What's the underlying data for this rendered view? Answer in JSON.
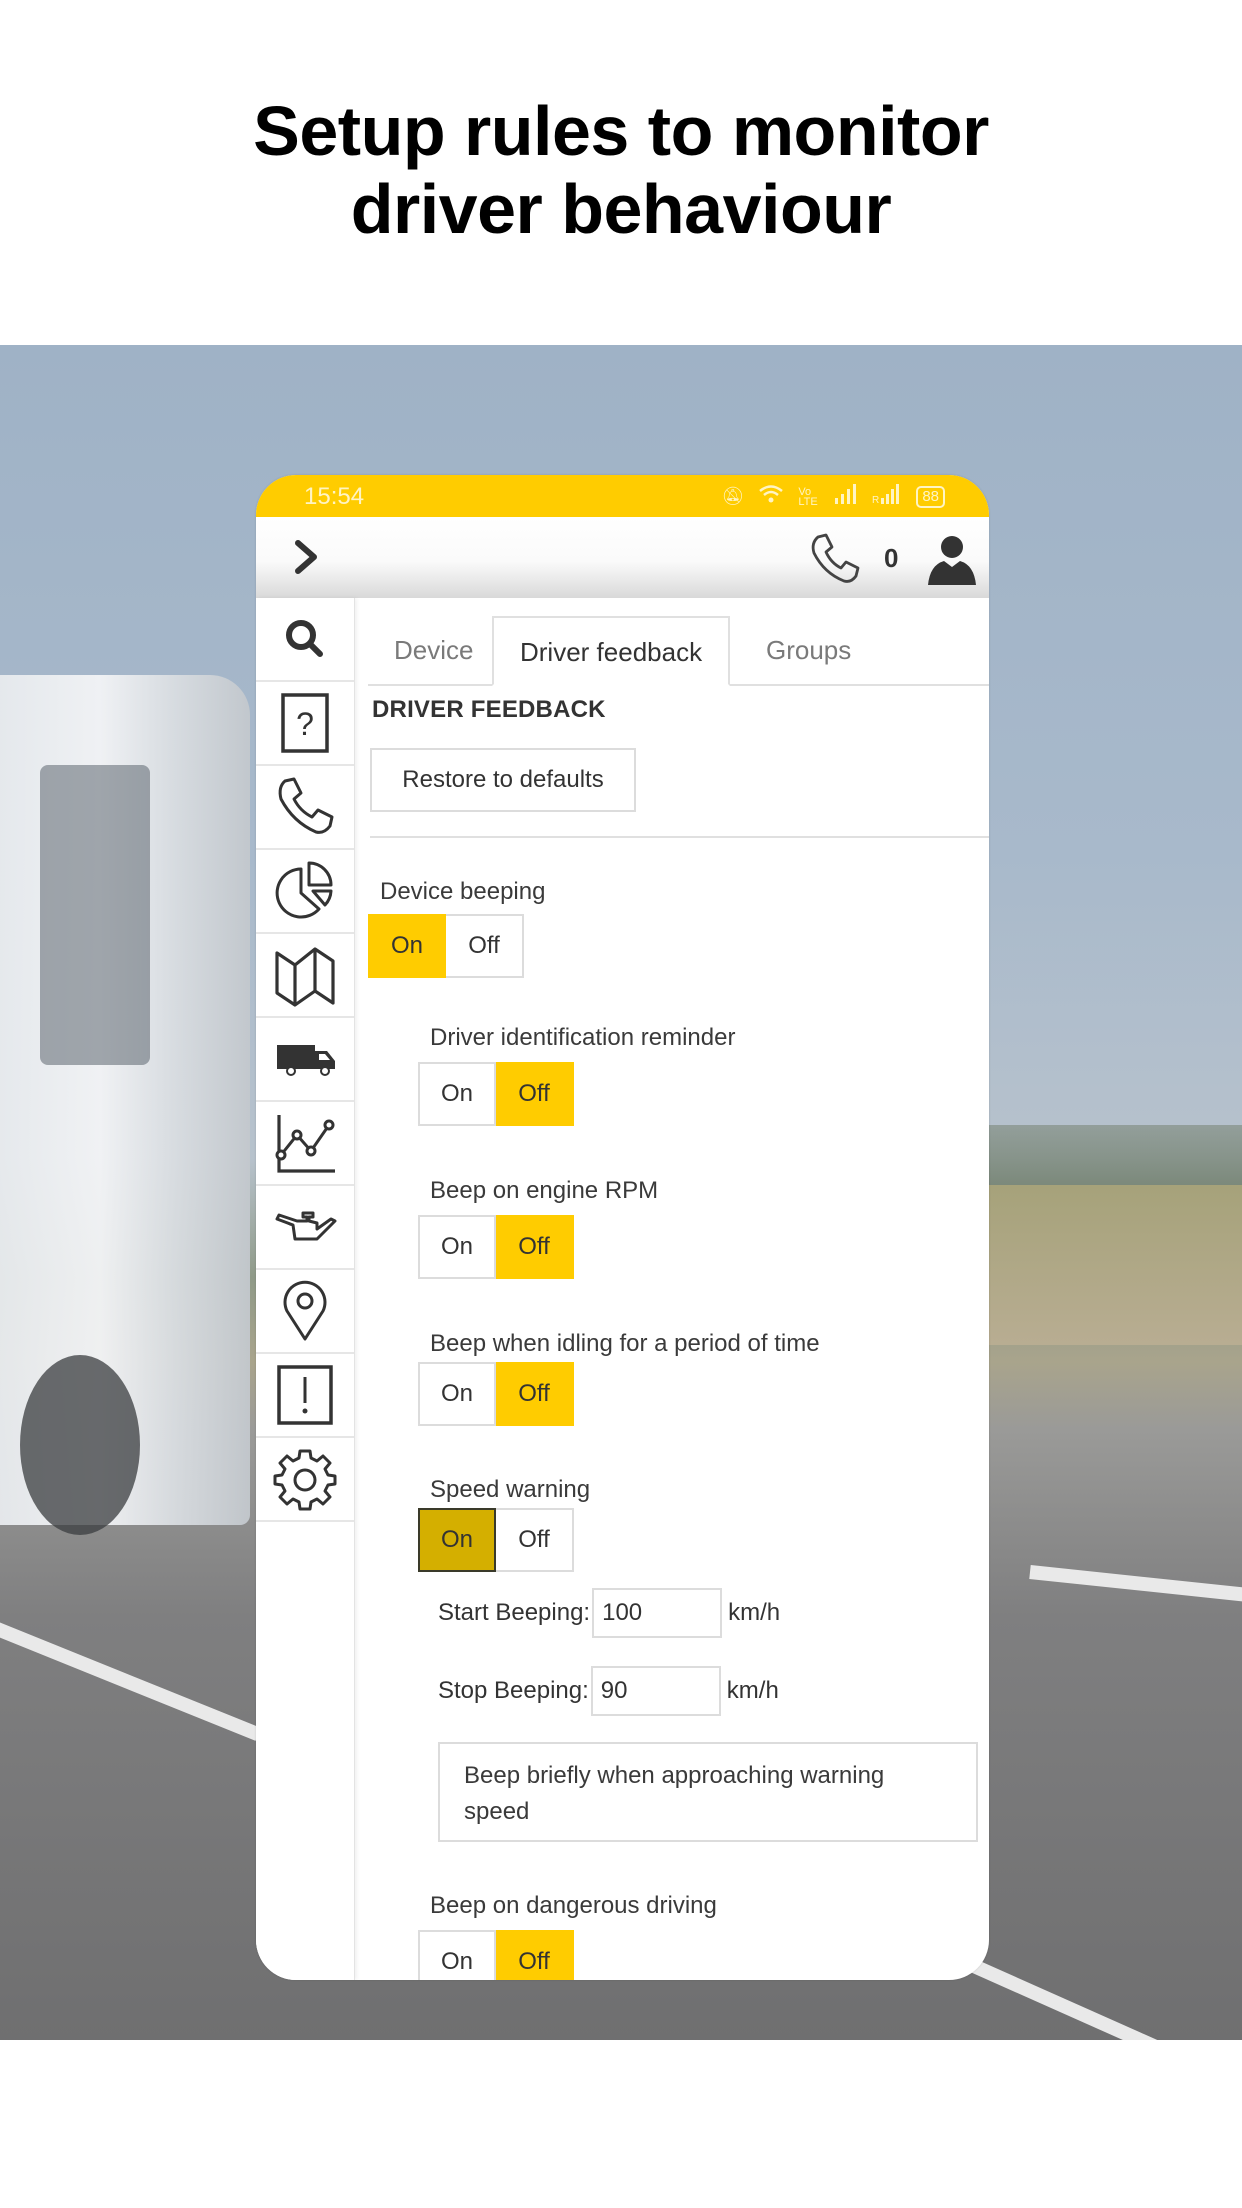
{
  "headline": {
    "line1": "Setup rules to monitor",
    "line2": "driver behaviour"
  },
  "colors": {
    "accent": "#FFCC00",
    "accent_pressed": "#D4AF00",
    "text": "#333333",
    "border": "#DCDCDC"
  },
  "status_bar": {
    "time": "15:54",
    "icons": [
      "mute-icon",
      "wifi-icon",
      "volte-icon",
      "signal-icon",
      "roaming-signal-icon",
      "battery-icon"
    ],
    "volte": "Vo LTE",
    "battery": "88"
  },
  "header": {
    "expand_icon": "chevron-right-icon",
    "phone_icon": "phone-icon",
    "call_count": "0",
    "user_icon": "user-icon"
  },
  "sidebar": {
    "items": [
      {
        "name": "search",
        "icon": "search-icon"
      },
      {
        "name": "help",
        "icon": "help-icon"
      },
      {
        "name": "calls",
        "icon": "phone-icon"
      },
      {
        "name": "reports",
        "icon": "pie-chart-icon"
      },
      {
        "name": "map",
        "icon": "map-icon"
      },
      {
        "name": "vehicles",
        "icon": "truck-icon"
      },
      {
        "name": "statistics",
        "icon": "line-chart-icon"
      },
      {
        "name": "maintenance",
        "icon": "oil-can-icon"
      },
      {
        "name": "places",
        "icon": "location-pin-icon"
      },
      {
        "name": "alerts",
        "icon": "alert-icon"
      },
      {
        "name": "settings",
        "icon": "gear-icon"
      }
    ]
  },
  "tabs": [
    {
      "label": "Device",
      "active": false
    },
    {
      "label": "Driver feedback",
      "active": true
    },
    {
      "label": "Groups",
      "active": false
    }
  ],
  "main": {
    "section_title": "DRIVER FEEDBACK",
    "restore_label": "Restore to defaults",
    "settings": [
      {
        "label": "Device beeping",
        "on_label": "On",
        "off_label": "Off",
        "value": "On"
      },
      {
        "label": "Driver identification reminder",
        "on_label": "On",
        "off_label": "Off",
        "value": "Off"
      },
      {
        "label": "Beep on engine RPM",
        "on_label": "On",
        "off_label": "Off",
        "value": "Off"
      },
      {
        "label": "Beep when idling for a period of time",
        "on_label": "On",
        "off_label": "Off",
        "value": "Off"
      },
      {
        "label": "Speed warning",
        "on_label": "On",
        "off_label": "Off",
        "value": "On"
      },
      {
        "label": "Beep on dangerous driving",
        "on_label": "On",
        "off_label": "Off",
        "value": "Off"
      }
    ],
    "speed_warning": {
      "start_label": "Start Beeping:",
      "start_value": "100",
      "stop_label": "Stop Beeping:",
      "stop_value": "90",
      "unit": "km/h",
      "approach_option": "Beep briefly when approaching warning speed"
    }
  }
}
